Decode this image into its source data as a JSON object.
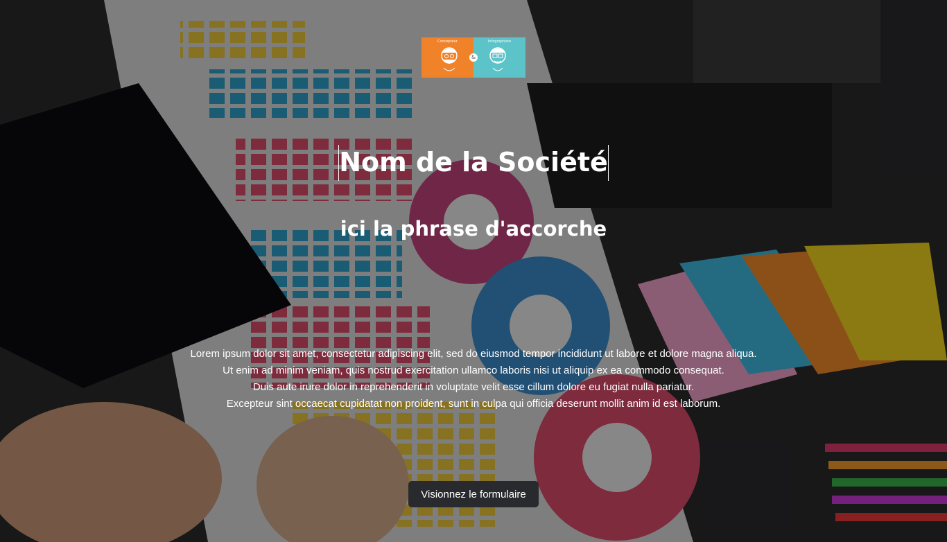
{
  "logo": {
    "left_caption": "Concepteur",
    "right_caption": "Infographiste",
    "ampersand": "&"
  },
  "hero": {
    "title": "Nom de la Société",
    "tagline": "ici la phrase d'accorche",
    "paragraph_lines": [
      "Lorem ipsum dolor sit amet, consectetur adipiscing elit, sed do eiusmod tempor incididunt ut labore et dolore magna aliqua.",
      "Ut enim ad minim veniam, quis nostrud exercitation ullamco laboris nisi ut aliquip ex ea commodo consequat.",
      "Duis aute irure dolor in reprehenderit in voluptate velit esse cillum dolore eu fugiat nulla pariatur.",
      "Excepteur sint occaecat cupidatat non proident, sunt in culpa qui officia deserunt mollit anim id est laborum."
    ],
    "cta_label": "Visionnez le formulaire"
  },
  "colors": {
    "logo_left": "#f0822a",
    "logo_right": "#5cc3c8",
    "button_bg": "#292a2e"
  }
}
